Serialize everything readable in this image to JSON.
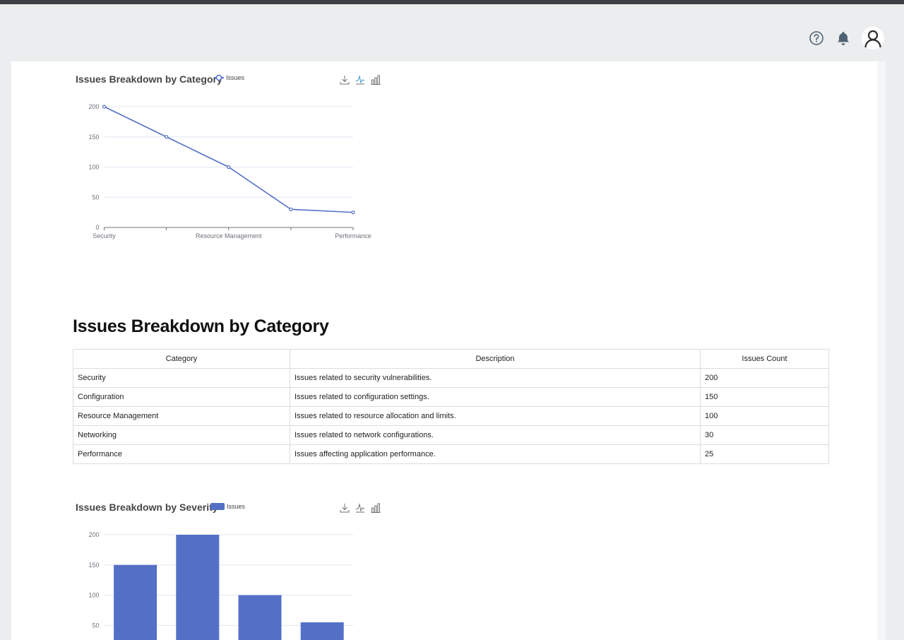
{
  "header": {
    "help_icon": "help-circle-icon",
    "notification_icon": "bell-icon",
    "profile_icon": "user-icon"
  },
  "charts": [
    {
      "title": "Issues Breakdown by Category",
      "legend_label": "Issues",
      "toolbox": [
        "download-icon",
        "line-chart-icon",
        "bar-chart-icon"
      ]
    },
    {
      "title": "Issues Breakdown by Severity",
      "legend_label": "Issues",
      "toolbox": [
        "download-icon",
        "line-chart-icon",
        "bar-chart-icon"
      ]
    }
  ],
  "chart_data": [
    {
      "type": "line",
      "title": "Issues Breakdown by Category",
      "categories": [
        "Security",
        "Configuration",
        "Resource Management",
        "Networking",
        "Performance"
      ],
      "x_tick_labels_shown": [
        "Security",
        "Resource Management",
        "Performance"
      ],
      "series": [
        {
          "name": "Issues",
          "values": [
            200,
            150,
            100,
            30,
            25
          ]
        }
      ],
      "yticks": [
        "0",
        "50",
        "100",
        "150",
        "200"
      ],
      "ylim": [
        0,
        200
      ],
      "grid": true,
      "legend_position": "top",
      "color": "#5470c6"
    },
    {
      "type": "bar",
      "title": "Issues Breakdown by Severity",
      "series": [
        {
          "name": "Issues",
          "values": [
            150,
            200,
            100,
            55
          ]
        }
      ],
      "yticks": [
        "50",
        "100",
        "150",
        "200"
      ],
      "ylim": [
        0,
        200
      ],
      "grid": true,
      "legend_position": "top",
      "color": "#5470c6"
    }
  ],
  "section": {
    "title": "Issues Breakdown by Category"
  },
  "table": {
    "headers": [
      "Category",
      "Description",
      "Issues Count"
    ],
    "rows": [
      [
        "Security",
        "Issues related to security vulnerabilities.",
        "200"
      ],
      [
        "Configuration",
        "Issues related to configuration settings.",
        "150"
      ],
      [
        "Resource Management",
        "Issues related to resource allocation and limits.",
        "100"
      ],
      [
        "Networking",
        "Issues related to network configurations.",
        "30"
      ],
      [
        "Performance",
        "Issues affecting application performance.",
        "25"
      ]
    ]
  }
}
